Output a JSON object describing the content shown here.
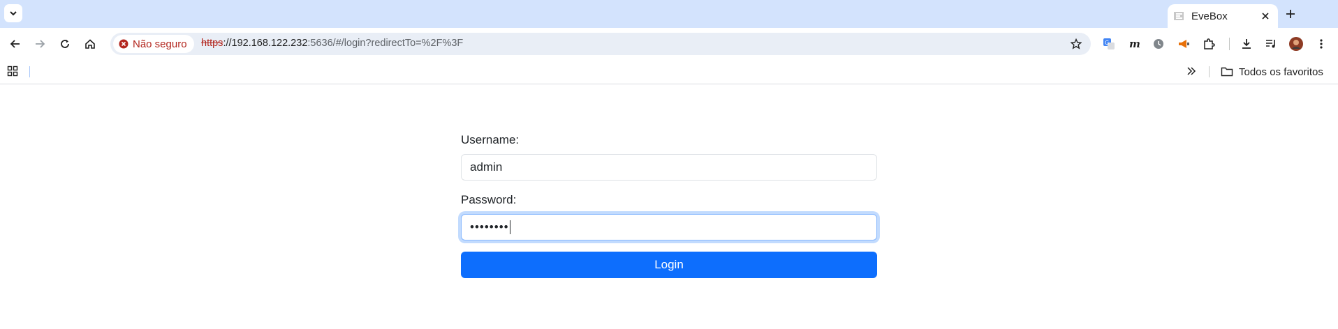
{
  "browser": {
    "tab": {
      "title": "EveBox"
    },
    "omnibox": {
      "security_chip": "Não seguro",
      "url_scheme": "https",
      "url_host": "://192.168.122.232",
      "url_path": ":5636/#/login?redirectTo=%2F%3F"
    },
    "bookmarks": {
      "folder_label": "Todos os favoritos"
    },
    "colors": {
      "tabstrip": "#d3e3fd",
      "omnibox": "#e9eef6",
      "danger": "#b3261e"
    }
  },
  "login": {
    "username_label": "Username:",
    "username_value": "admin",
    "password_label": "Password:",
    "password_masked": "••••••••",
    "submit_label": "Login",
    "accent": "#0d6efd"
  }
}
